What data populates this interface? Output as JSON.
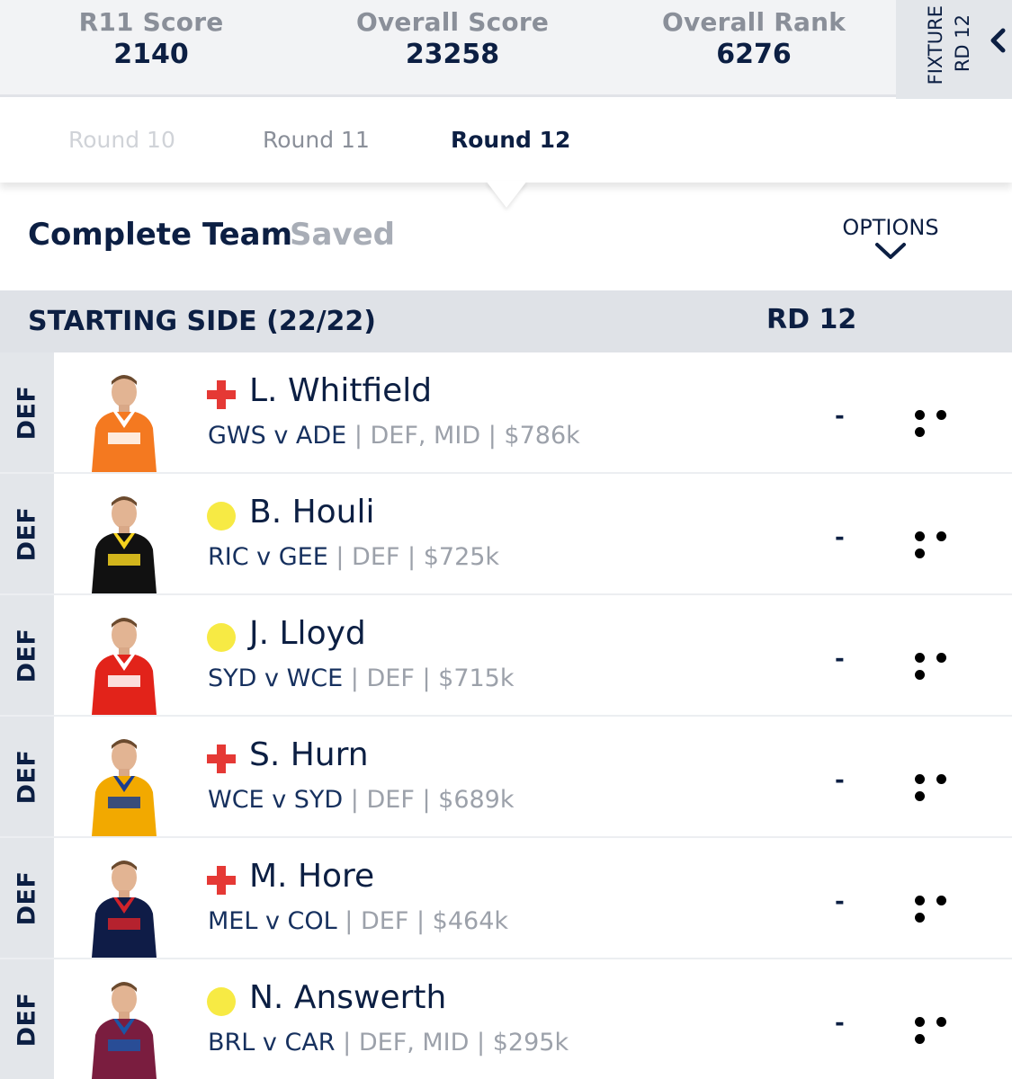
{
  "stats": [
    {
      "label": "R11 Score",
      "value": "2140"
    },
    {
      "label": "Overall Score",
      "value": "23258"
    },
    {
      "label": "Overall Rank",
      "value": "6276"
    }
  ],
  "fixture": {
    "line1": "FIXTURE",
    "line2": "RD 12",
    "icon": "chevron-left-icon"
  },
  "rounds": [
    "Round 10",
    "Round 11",
    "Round 12"
  ],
  "active_round": "Round 12",
  "team_status": {
    "complete": "Complete Team",
    "saved": "Saved",
    "options": "OPTIONS"
  },
  "starting_side": {
    "title": "STARTING SIDE (22/22)",
    "round": "RD 12"
  },
  "colors": {
    "navy": "#0c1f43",
    "injury": "#e53935",
    "uncertain": "#f7ea44",
    "band": "#dfe2e7"
  },
  "players": [
    {
      "position": "DEF",
      "status": "injured",
      "name": "L. Whitfield",
      "match": "GWS v ADE",
      "positions": "DEF, MID",
      "price": "$786k",
      "score": "-",
      "jersey": [
        "#f47920",
        "#ffffff"
      ]
    },
    {
      "position": "DEF",
      "status": "uncertain",
      "name": "B. Houli",
      "match": "RIC v GEE",
      "positions": "DEF",
      "price": "$725k",
      "score": "-",
      "jersey": [
        "#111111",
        "#f5d21e"
      ]
    },
    {
      "position": "DEF",
      "status": "uncertain",
      "name": "J. Lloyd",
      "match": "SYD v WCE",
      "positions": "DEF",
      "price": "$715k",
      "score": "-",
      "jersey": [
        "#e2231a",
        "#ffffff"
      ]
    },
    {
      "position": "DEF",
      "status": "injured",
      "name": "S. Hurn",
      "match": "WCE v SYD",
      "positions": "DEF",
      "price": "$689k",
      "score": "-",
      "jersey": [
        "#f2a900",
        "#1a3d8f"
      ]
    },
    {
      "position": "DEF",
      "status": "injured",
      "name": "M. Hore",
      "match": "MEL v COL",
      "positions": "DEF",
      "price": "$464k",
      "score": "-",
      "jersey": [
        "#0f1c47",
        "#d2232a"
      ]
    },
    {
      "position": "DEF",
      "status": "uncertain",
      "name": "N. Answerth",
      "match": "BRL v CAR",
      "positions": "DEF, MID",
      "price": "$295k",
      "score": "-",
      "jersey": [
        "#7a1d3f",
        "#1b56a6"
      ]
    }
  ]
}
